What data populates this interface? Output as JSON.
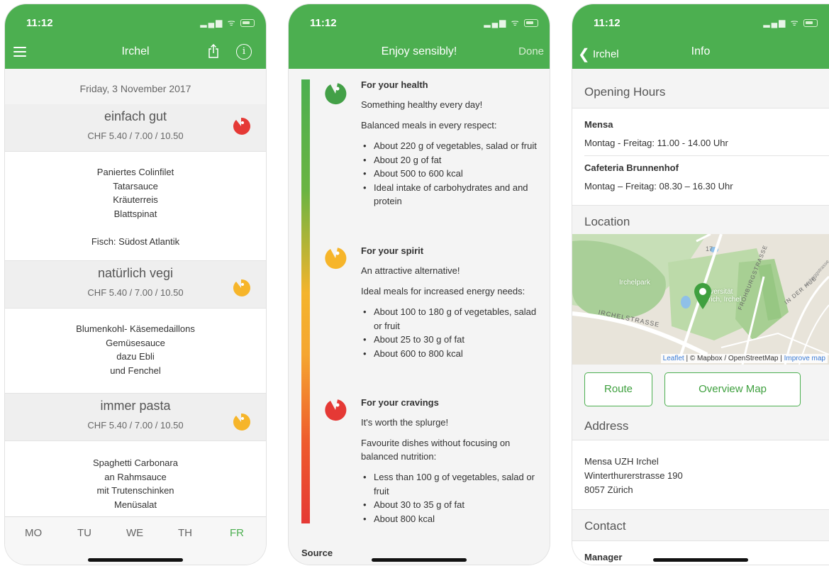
{
  "status": {
    "time": "11:12"
  },
  "colors": {
    "accent": "#4caf50",
    "health": "#43a047",
    "spirit": "#f6b52a",
    "cravings": "#e53935"
  },
  "screen1": {
    "title": "Irchel",
    "icons": {
      "menu": "hamburger-icon",
      "share": "share-icon",
      "info": "info-icon"
    },
    "date": "Friday, 3 November 2017",
    "menus": [
      {
        "name": "einfach gut",
        "price": "CHF 5.40 / 7.00 / 10.50",
        "rating": "cravings",
        "lines": [
          "Paniertes Colinfilet",
          "Tatarsauce",
          "Kräuterreis",
          "Blattspinat",
          "",
          "Fisch: Südost Atlantik"
        ]
      },
      {
        "name": "natürlich vegi",
        "price": "CHF 5.40 / 7.00 / 10.50",
        "rating": "spirit",
        "lines": [
          "Blumenkohl- Käsemedaillons",
          "Gemüsesauce",
          "dazu Ebli",
          "und Fenchel"
        ]
      },
      {
        "name": "immer pasta",
        "price": "CHF 5.40 / 7.00 / 10.50",
        "rating": "spirit",
        "lines": [
          "Spaghetti Carbonara",
          "an Rahmsauce",
          "mit Trutenschinken",
          "Menüsalat"
        ]
      }
    ],
    "tabs": [
      "MO",
      "TU",
      "WE",
      "TH",
      "FR"
    ],
    "active_tab": "FR"
  },
  "screen2": {
    "title": "Enjoy sensibly!",
    "done": "Done",
    "sections": [
      {
        "title": "For your health",
        "line1": "Something healthy every day!",
        "line2": "Balanced meals in every respect:",
        "bullets": [
          "About 220 g of vegetables, salad or fruit",
          "About 20 g of fat",
          "About 500 to 600 kcal",
          "Ideal intake of carbohydrates and and protein"
        ]
      },
      {
        "title": "For your spirit",
        "line1": "An attractive alternative!",
        "line2": "Ideal meals for increased energy needs:",
        "bullets": [
          "About 100 to 180 g of vegetables, salad or fruit",
          "About 25 to 30 g of fat",
          "About 600 to 800 kcal"
        ]
      },
      {
        "title": "For your cravings",
        "line1": "It's worth the splurge!",
        "line2": "Favourite dishes without focusing on balanced nutrition:",
        "bullets": [
          "Less than 100 g of vegetables, salad or fruit",
          "About 30 to 35 g of fat",
          "About 800 kcal"
        ]
      }
    ],
    "source": "Source"
  },
  "screen3": {
    "back": "Irchel",
    "title": "Info",
    "opening_hours": "Opening Hours",
    "mensa": "Mensa",
    "mensa_hours": "Montag - Freitag: 11.00 - 14.00 Uhr",
    "cafeteria": "Cafeteria Brunnenhof",
    "cafeteria_hours": "Montag – Freitag: 08.30 – 16.30 Uhr",
    "location": "Location",
    "map": {
      "park": "Irchelpark",
      "street": "IRCHELSTRASSE",
      "street2": "FROHBURGSTRASSE",
      "street3": "IN DER HUB",
      "street4": "Hubeggstrasse",
      "road_num": "17",
      "uni1": "iversität",
      "uni2": "rich, Irchel",
      "attr_leaflet": "Leaflet",
      "attr_mid": " | © Mapbox / OpenStreetMap | ",
      "attr_improve": "Improve map"
    },
    "route": "Route",
    "overview": "Overview Map",
    "address": "Address",
    "addr1": "Mensa UZH Irchel",
    "addr2": "Winterthurerstrasse 190",
    "addr3": "8057 Zürich",
    "contact": "Contact",
    "manager": "Manager"
  }
}
